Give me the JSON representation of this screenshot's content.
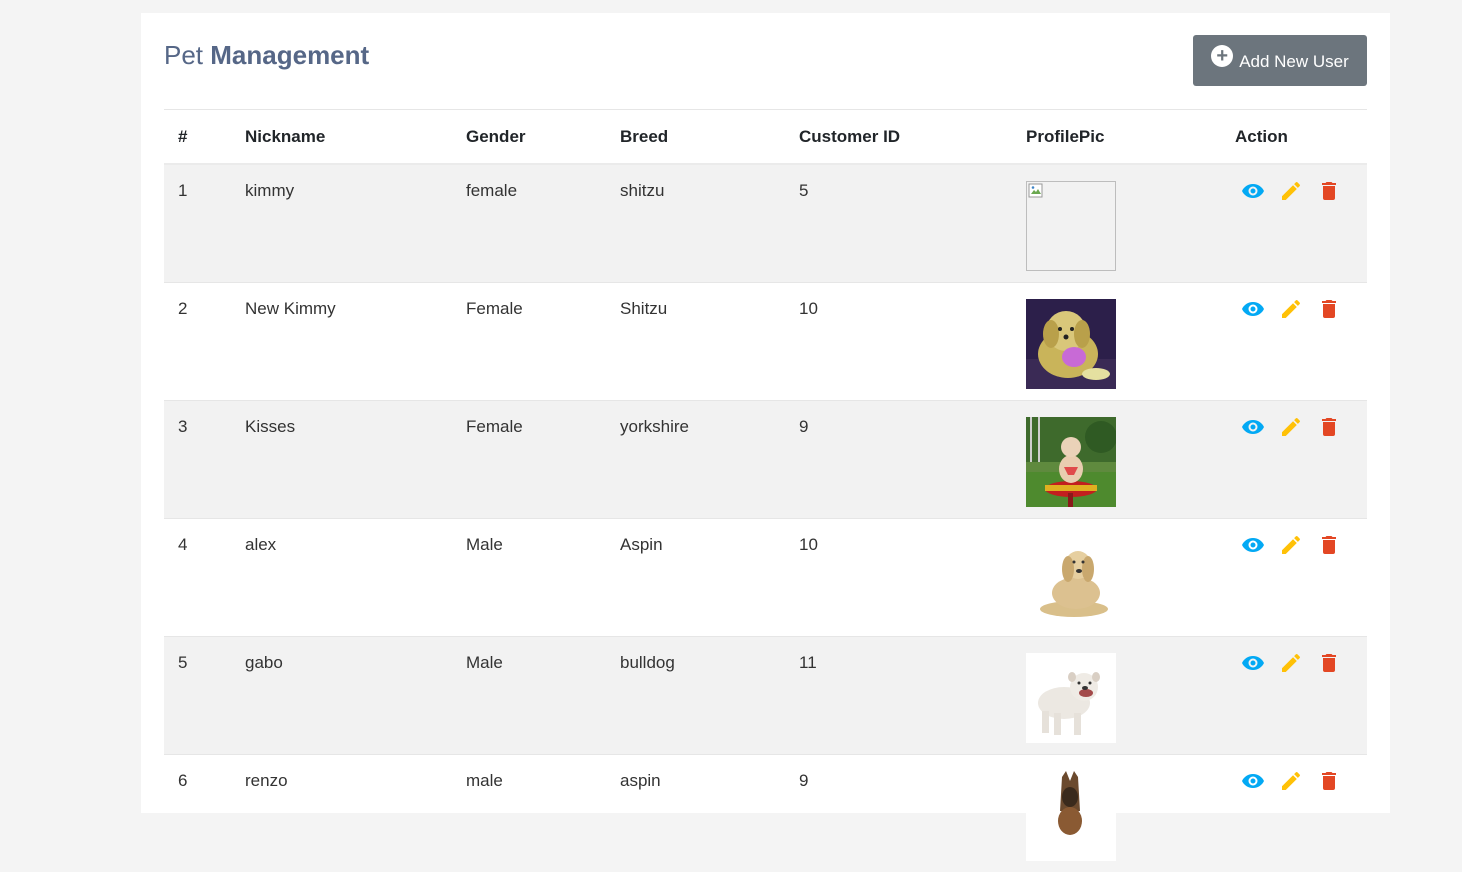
{
  "header": {
    "title_light": "Pet",
    "title_bold": "Management",
    "add_button_label": "Add New User"
  },
  "table": {
    "columns": [
      "#",
      "Nickname",
      "Gender",
      "Breed",
      "Customer ID",
      "ProfilePic",
      "Action"
    ],
    "rows": [
      {
        "num": "1",
        "nickname": "kimmy",
        "gender": "female",
        "breed": "shitzu",
        "customer_id": "5",
        "pic": "broken-image"
      },
      {
        "num": "2",
        "nickname": "New Kimmy",
        "gender": "Female",
        "breed": "Shitzu",
        "customer_id": "10",
        "pic": "fluffy-dog-photo"
      },
      {
        "num": "3",
        "nickname": "Kisses",
        "gender": "Female",
        "breed": "yorkshire",
        "customer_id": "9",
        "pic": "dog-on-red-stool-photo"
      },
      {
        "num": "4",
        "nickname": "alex",
        "gender": "Male",
        "breed": "Aspin",
        "customer_id": "10",
        "pic": "golden-retriever-photo"
      },
      {
        "num": "5",
        "nickname": "gabo",
        "gender": "Male",
        "breed": "bulldog",
        "customer_id": "11",
        "pic": "white-bulldog-photo"
      },
      {
        "num": "6",
        "nickname": "renzo",
        "gender": "male",
        "breed": "aspin",
        "customer_id": "9",
        "pic": "german-shepherd-photo"
      }
    ]
  },
  "icons": {
    "view": "eye-icon",
    "edit": "pencil-icon",
    "delete": "trash-icon",
    "add": "plus-circle-icon"
  },
  "colors": {
    "title": "#566787",
    "button": "#6c757d",
    "view": "#03a9f4",
    "edit": "#ffc107",
    "delete": "#e34724",
    "row_stripe": "#f2f2f2"
  }
}
